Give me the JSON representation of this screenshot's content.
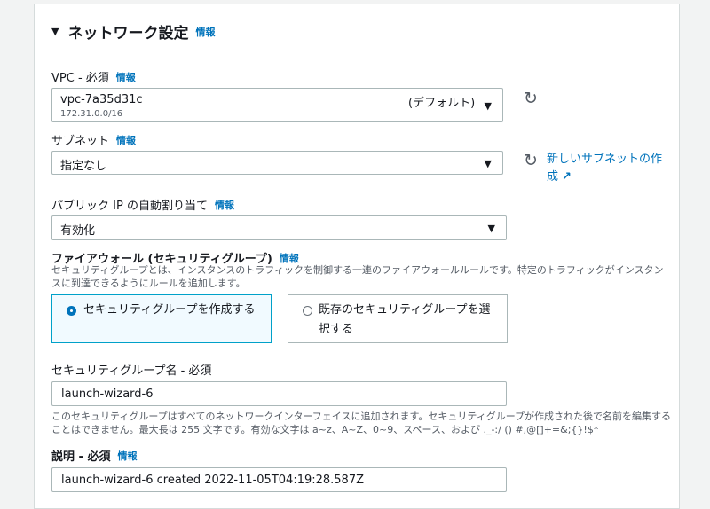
{
  "section": {
    "title": "ネットワーク設定",
    "info": "情報"
  },
  "vpc": {
    "label": "VPC - 必須",
    "info": "情報",
    "value": "vpc-7a35d31c",
    "sub": "172.31.0.0/16",
    "tag": "(デフォルト)"
  },
  "subnet": {
    "label": "サブネット",
    "info": "情報",
    "value": "指定なし",
    "new_link": "新しいサブネットの作成"
  },
  "public_ip": {
    "label": "パブリック IP の自動割り当て",
    "info": "情報",
    "value": "有効化"
  },
  "firewall": {
    "label": "ファイアウォール (セキュリティグループ)",
    "info": "情報",
    "desc": "セキュリティグループとは、インスタンスのトラフィックを制御する一連のファイアウォールルールです。特定のトラフィックがインスタンスに到達できるようにルールを追加します。",
    "options": [
      {
        "label": "セキュリティグループを作成する",
        "selected": true
      },
      {
        "label": "既存のセキュリティグループを選択する",
        "selected": false
      }
    ]
  },
  "sg_name": {
    "label": "セキュリティグループ名 - 必須",
    "value": "launch-wizard-6",
    "desc": "このセキュリティグループはすべてのネットワークインターフェイスに追加されます。セキュリティグループが作成された後で名前を編集することはできません。最大長は 255 文字です。有効な文字は a~z、A~Z、0~9、スペース、および ._-:/ () #,@[]+=&;{}!$*"
  },
  "description": {
    "label": "説明 - 必須",
    "info": "情報",
    "value": "launch-wizard-6 created 2022-11-05T04:19:28.587Z"
  },
  "icons": {
    "caret": "caret-down-icon",
    "refresh": "refresh-icon",
    "external": "external-link-icon",
    "dropdown": "chevron-down-icon"
  },
  "colors": {
    "link": "#0073bb",
    "selected_border": "#00a1c9",
    "selected_bg": "#f1faff"
  }
}
